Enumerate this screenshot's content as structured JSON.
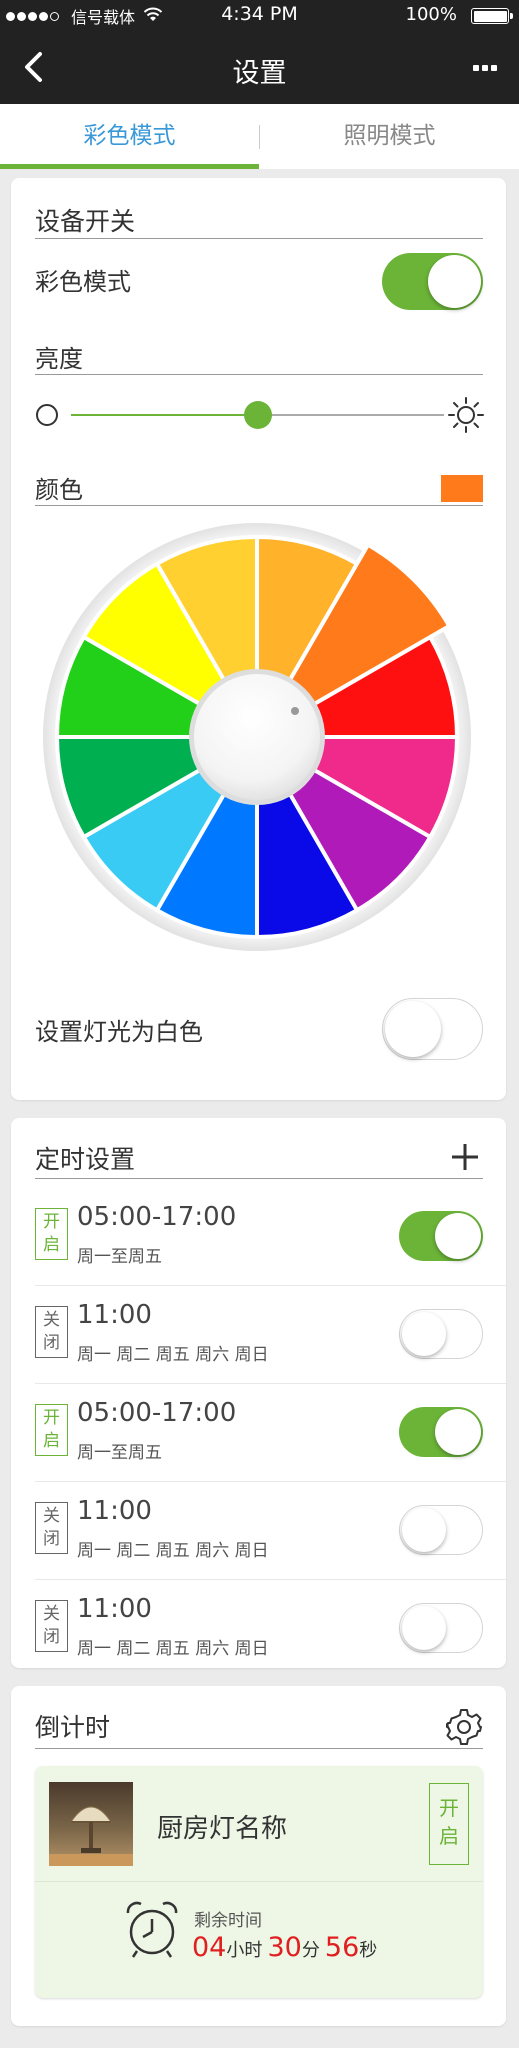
{
  "status_bar": {
    "carrier": "信号载体",
    "time": "4:34 PM",
    "battery": "100%"
  },
  "nav": {
    "title": "设置"
  },
  "tabs": [
    {
      "label": "彩色模式",
      "active": true
    },
    {
      "label": "照明模式",
      "active": false
    }
  ],
  "device": {
    "section_title": "设备开关",
    "color_mode_label": "彩色模式",
    "color_mode_on": true,
    "brightness_label": "亮度",
    "brightness_level": 0.5,
    "color_label": "颜色",
    "selected_color": "#ff7a1a",
    "white_light_label": "设置灯光为白色",
    "white_light_on": false
  },
  "color_wheel": {
    "segments": [
      "#ffb22a",
      "#ff7a1a",
      "#ff1010",
      "#f02a8a",
      "#b01ab8",
      "#0a0ae8",
      "#0078ff",
      "#3acbf5",
      "#00b050",
      "#22d01a",
      "#ffff00",
      "#ffd030"
    ],
    "selected_index": 1
  },
  "schedule": {
    "title": "定时设置",
    "on_badge": "开启",
    "off_badge": "关闭",
    "items": [
      {
        "time": "05:00-17:00",
        "days": "周一至周五",
        "on": true
      },
      {
        "time": "11:00",
        "days": "周一  周二  周五  周六  周日",
        "on": false
      },
      {
        "time": "05:00-17:00",
        "days": "周一至周五",
        "on": true
      },
      {
        "time": "11:00",
        "days": "周一  周二  周五  周六  周日",
        "on": false
      },
      {
        "time": "11:00",
        "days": "周一  周二  周五  周六  周日",
        "on": false
      }
    ]
  },
  "countdown": {
    "title": "倒计时",
    "device_name": "厨房灯名称",
    "badge": "开启",
    "remaining_label": "剩余时间",
    "hours": "04",
    "hours_unit": "小时",
    "minutes": "30",
    "minutes_unit": "分",
    "seconds": "56",
    "seconds_unit": "秒"
  },
  "colors": {
    "accent_green": "#6bb438",
    "tab_blue": "#3a98d8",
    "countdown_red": "#e02020"
  }
}
